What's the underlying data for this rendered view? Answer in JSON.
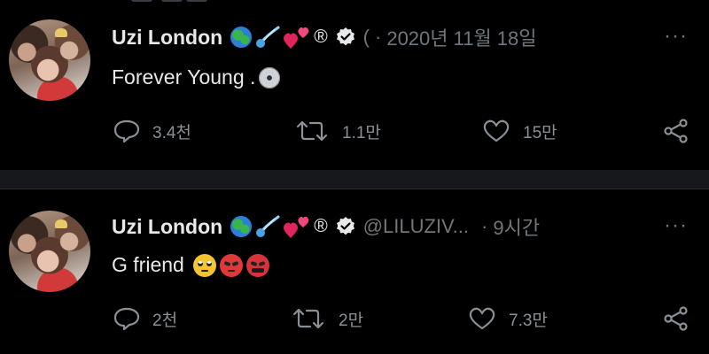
{
  "tweets": [
    {
      "author_name": "Uzi London",
      "badge_text": "®",
      "handle": "(",
      "separator": "·",
      "time": "2020년 11월 18일",
      "more": "···",
      "text": "Forever Young .",
      "replies": "3.4천",
      "retweets": "1.1만",
      "likes": "15만"
    },
    {
      "author_name": "Uzi London",
      "badge_text": "®",
      "handle": "@LILUZIV...",
      "separator": "·",
      "time": "9시간",
      "more": "···",
      "text": "G friend",
      "replies": "2천",
      "retweets": "2만",
      "likes": "7.3만"
    }
  ],
  "icons": [
    "globe-emoji-icon",
    "comet-emoji-icon",
    "hearts-emoji-icon",
    "verified-badge-icon",
    "cd-emoji-icon",
    "eye-roll-emoji-icon",
    "angry-face-emoji-icon",
    "cursing-face-emoji-icon",
    "reply-icon",
    "retweet-icon",
    "like-icon",
    "share-icon",
    "more-icon"
  ],
  "colors": {
    "background": "#000000",
    "text": "#e7e9ea",
    "muted": "#71767b",
    "divider": "#16181c"
  }
}
